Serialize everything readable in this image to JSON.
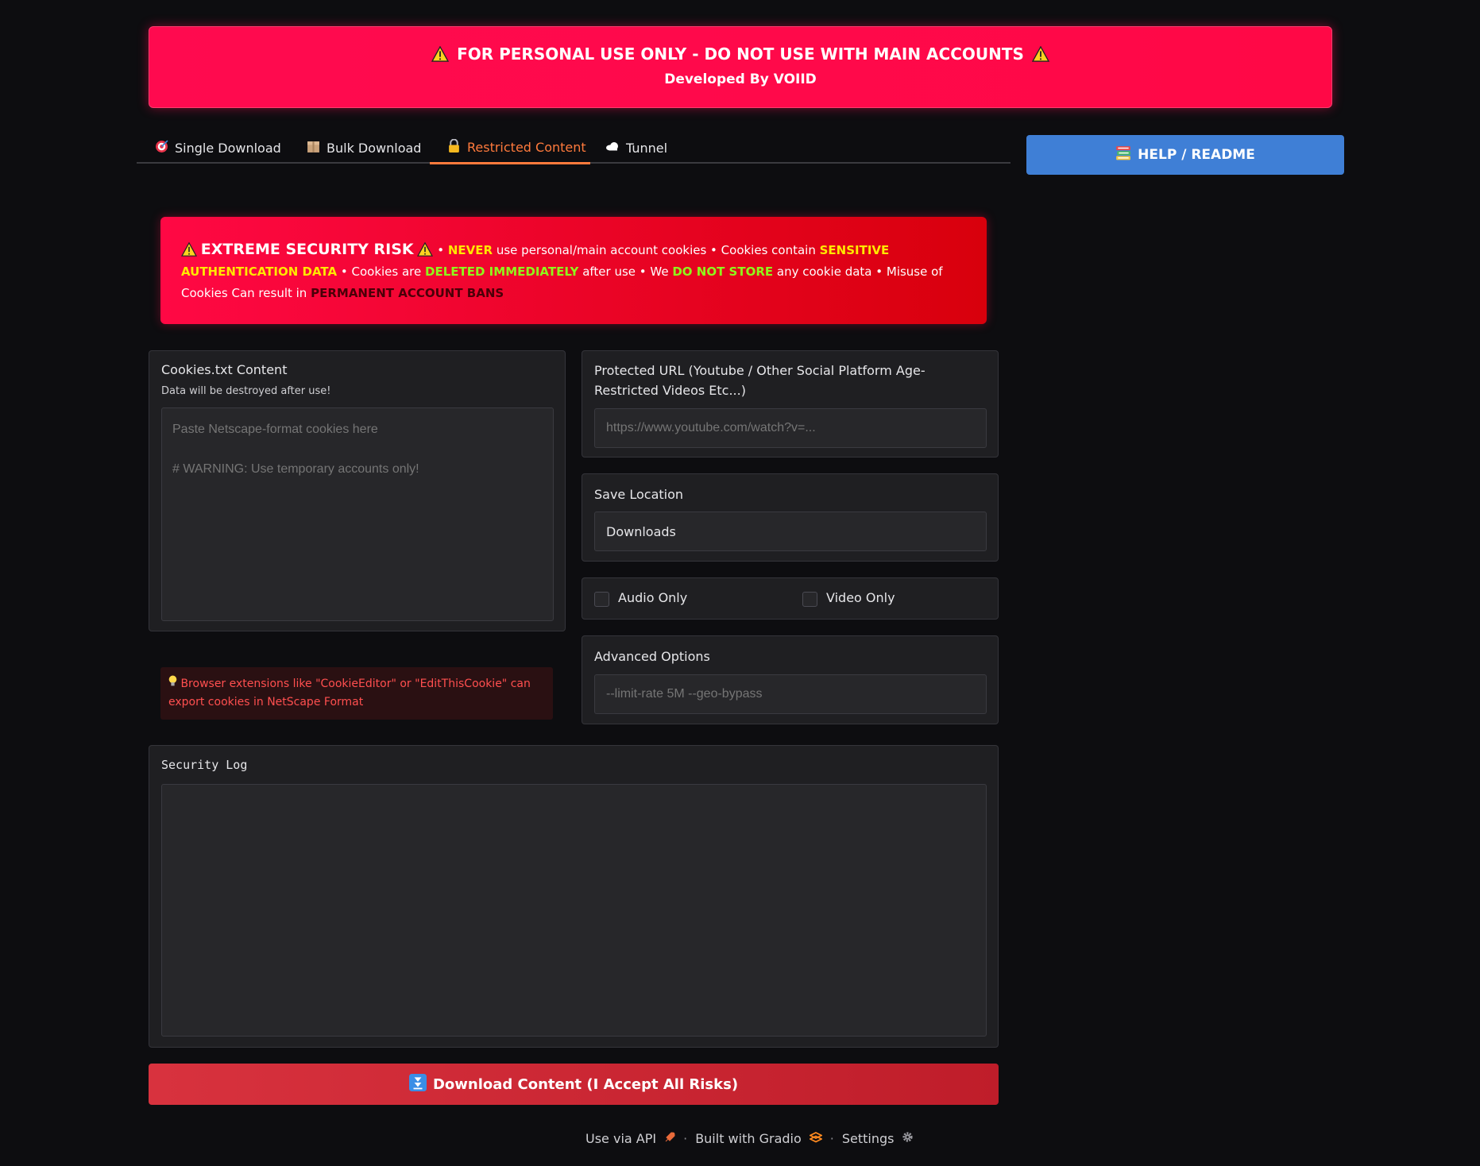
{
  "banner": {
    "title": "FOR PERSONAL USE ONLY - DO NOT USE WITH MAIN ACCOUNTS",
    "subtitle": "Developed By VOIID"
  },
  "tabs": [
    {
      "label": "Single Download",
      "icon": "target-icon"
    },
    {
      "label": "Bulk Download",
      "icon": "package-icon"
    },
    {
      "label": "Restricted Content",
      "icon": "lock-icon"
    },
    {
      "label": "Tunnel",
      "icon": "cloud-icon"
    }
  ],
  "help_button": {
    "label": "HELP / README",
    "icon": "books-icon"
  },
  "risk": {
    "title": "EXTREME SECURITY RISK",
    "s1": "•",
    "never": "NEVER",
    "s2": "use personal/main account cookies • Cookies contain",
    "sensitive": "SENSITIVE AUTHENTICATION DATA",
    "s3": "• Cookies are",
    "deleted": "DELETED IMMEDIATELY",
    "s4": "after use • We",
    "nostore": "DO NOT STORE",
    "s5": "any cookie data • Misuse of Cookies Can result in",
    "bans": "PERMANENT ACCOUNT BANS"
  },
  "cookies": {
    "label": "Cookies.txt Content",
    "sublabel": "Data will be destroyed after use!",
    "placeholder": "Paste Netscape-format cookies here\n\n# WARNING: Use temporary accounts only!"
  },
  "tip": {
    "text": "Browser extensions like \"CookieEditor\" or \"EditThisCookie\" can export cookies in NetScape Format",
    "icon": "lightbulb-icon"
  },
  "url": {
    "label": "Protected URL (Youtube / Other Social Platform Age-Restricted Videos Etc...)",
    "placeholder": "https://www.youtube.com/watch?v=..."
  },
  "save": {
    "label": "Save Location",
    "value": "Downloads"
  },
  "options": {
    "audio_only": "Audio Only",
    "video_only": "Video Only"
  },
  "advanced": {
    "label": "Advanced Options",
    "placeholder": "--limit-rate 5M --geo-bypass"
  },
  "log": {
    "label": "Security Log"
  },
  "download_button": {
    "label": "Download Content (I Accept All Risks)",
    "icon": "down-arrow-icon"
  },
  "footer": {
    "api": "Use via API",
    "gradio": "Built with Gradio",
    "settings": "Settings",
    "sep": "·"
  },
  "colors": {
    "banner": "#ff0a4f",
    "accent": "#ff7a3c",
    "help": "#3f7fd6",
    "download": "#d8323e"
  }
}
